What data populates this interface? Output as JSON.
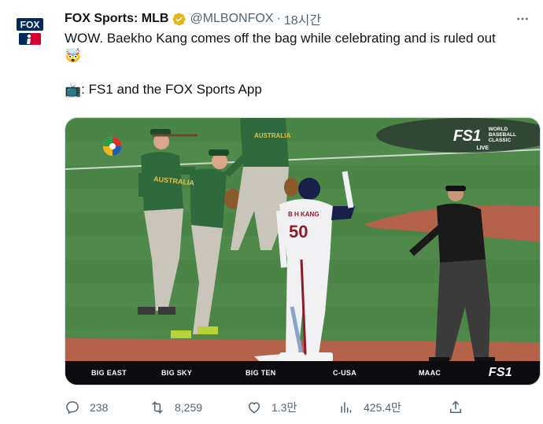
{
  "author": {
    "name": "FOX Sports: MLB",
    "handle": "@MLBONFOX",
    "separator": "·",
    "time": "18시간",
    "avatar_text": "FOX"
  },
  "tweet": {
    "line1": "WOW. Baekho Kang comes off the bag while celebrating and is ruled out",
    "line2_emoji": "🤯",
    "line3_emoji": "📺",
    "line3": ": FS1 and the FOX Sports App"
  },
  "media": {
    "broadcaster": "FS1",
    "live_label": "LIVE",
    "wbc_label": [
      "WORLD",
      "BASEBALL",
      "CLASSIC"
    ],
    "jersey_name": "B H KANG",
    "jersey_number": "50",
    "team_text": "AUSTRALIA",
    "ticker": [
      "BIG EAST",
      "BIG SKY",
      "BIG TEN",
      "C-USA",
      "MAAC"
    ],
    "ticker_logo": "FS1"
  },
  "actions": {
    "replies": "238",
    "retweets": "8,259",
    "likes": "1.3만",
    "views": "425.4만"
  },
  "colors": {
    "text": "#0f1419",
    "secondary": "#536471",
    "verified": "#e2b719",
    "field_grass": "#4f8a4a",
    "field_dirt": "#b5624b"
  }
}
